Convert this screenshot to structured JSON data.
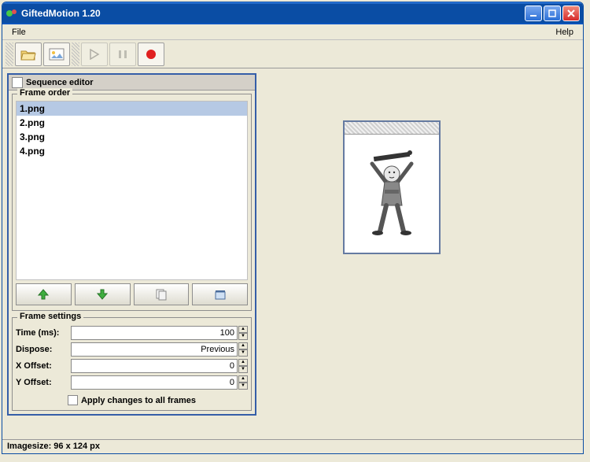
{
  "window": {
    "title": "GiftedMotion 1.20"
  },
  "menubar": {
    "file": "File",
    "help": "Help"
  },
  "toolbar": {
    "open": "open-icon",
    "image": "image-icon",
    "play": "play-icon",
    "pause": "pause-icon",
    "record": "record-icon"
  },
  "sequence_editor": {
    "title": "Sequence editor",
    "frame_order_label": "Frame order",
    "frames": [
      "1.png",
      "2.png",
      "3.png",
      "4.png"
    ],
    "selected_index": 0,
    "frame_settings_label": "Frame settings",
    "settings": {
      "time_label": "Time (ms):",
      "time_value": "100",
      "dispose_label": "Dispose:",
      "dispose_value": "Previous",
      "xoffset_label": "X Offset:",
      "xoffset_value": "0",
      "yoffset_label": "Y Offset:",
      "yoffset_value": "0"
    },
    "apply_all_label": "Apply changes to all frames",
    "apply_all_checked": false
  },
  "statusbar": {
    "text": "Imagesize: 96 x 124 px"
  }
}
